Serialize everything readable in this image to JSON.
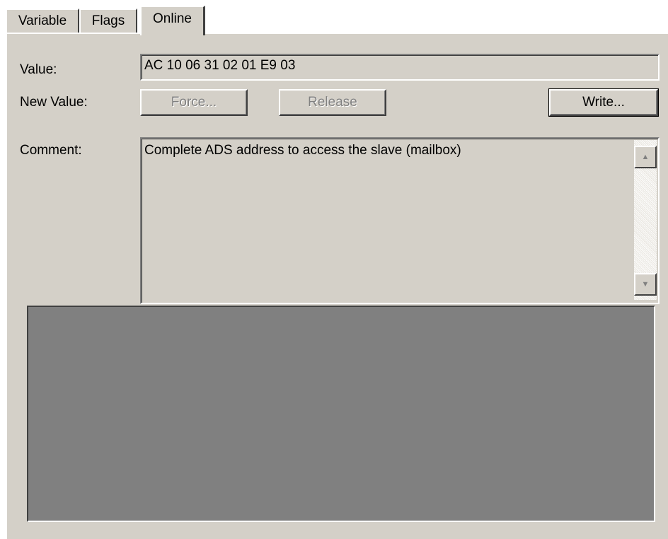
{
  "tabs": [
    {
      "label": "Variable",
      "active": false
    },
    {
      "label": "Flags",
      "active": false
    },
    {
      "label": "Online",
      "active": true
    }
  ],
  "labels": {
    "value": "Value:",
    "new_value": "New Value:",
    "comment": "Comment:"
  },
  "value_field": {
    "value": "AC 10 06 31 02 01 E9 03"
  },
  "buttons": {
    "force": {
      "label": "Force...",
      "enabled": false
    },
    "release": {
      "label": "Release",
      "enabled": false
    },
    "write": {
      "label": "Write...",
      "enabled": true
    }
  },
  "comment_field": {
    "value": "Complete ADS address to access the slave (mailbox)"
  },
  "scrollbar": {
    "up_icon": "arrow-up-icon",
    "down_icon": "arrow-down-icon"
  },
  "colors": {
    "face": "#d4d0c8",
    "empty_area": "#808080",
    "disabled_text": "#808080"
  }
}
